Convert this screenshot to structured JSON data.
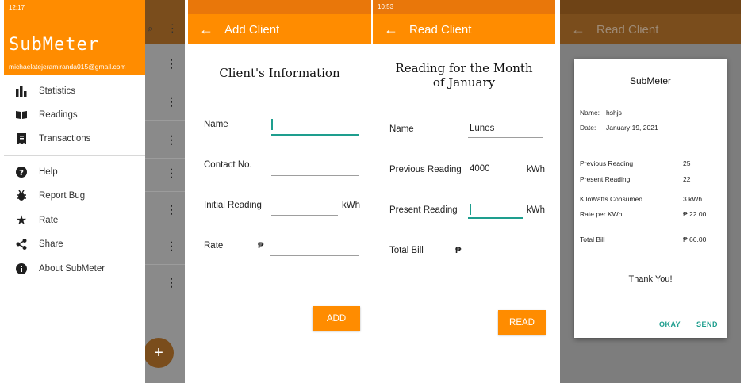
{
  "screen1": {
    "status_time": "12:17",
    "status_signal": ".. ▂▄",
    "status_right": "■ ◎ ▢",
    "app_title": "SubMeter",
    "email": "michaelatejeramiranda015@gmail.com",
    "menu": [
      {
        "label": "Statistics",
        "icon": "bar-chart-icon"
      },
      {
        "label": "Readings",
        "icon": "book-icon"
      },
      {
        "label": "Transactions",
        "icon": "receipt-icon"
      },
      {
        "label": "Help",
        "icon": "help-icon"
      },
      {
        "label": "Report Bug",
        "icon": "bug-icon"
      },
      {
        "label": "Rate",
        "icon": "star-icon"
      },
      {
        "label": "Share",
        "icon": "share-icon"
      },
      {
        "label": "About SubMeter",
        "icon": "info-icon"
      }
    ],
    "fab_label": "+"
  },
  "screen2": {
    "title": "Add Client",
    "form_title": "Client's Information",
    "name_label": "Name",
    "contact_label": "Contact No.",
    "initial_label": "Initial Reading",
    "initial_unit": "kWh",
    "rate_label": "Rate",
    "currency": "₱",
    "add_button": "ADD"
  },
  "screen3": {
    "status_time": "10:53",
    "title": "Read Client",
    "form_title": "Reading for the Month of January",
    "name_label": "Name",
    "name_value": "Lunes",
    "previous_label": "Previous Reading",
    "previous_value": "4000",
    "previous_unit": "kWh",
    "present_label": "Present Reading",
    "present_unit": "kWh",
    "total_label": "Total Bill",
    "currency": "₱",
    "read_button": "READ"
  },
  "screen4": {
    "title": "Read Client",
    "dialog": {
      "title": "SubMeter",
      "name_label": "Name:",
      "name_value": "hshjs",
      "date_label": "Date:",
      "date_value": "January 19, 2021",
      "previous_label": "Previous Reading",
      "previous_value": "25",
      "present_label": "Present Reading",
      "present_value": "22",
      "consumed_label": "KiloWatts Consumed",
      "consumed_value": "3 kWh",
      "rate_label": "Rate per KWh",
      "rate_value": "₱ 22.00",
      "total_label": "Total Bill",
      "total_value": "₱ 66.00",
      "thanks": "Thank You!",
      "okay_button": "OKAY",
      "send_button": "SEND"
    }
  },
  "colors": {
    "accent": "#ff8c00",
    "teal": "#1e9e8e"
  }
}
